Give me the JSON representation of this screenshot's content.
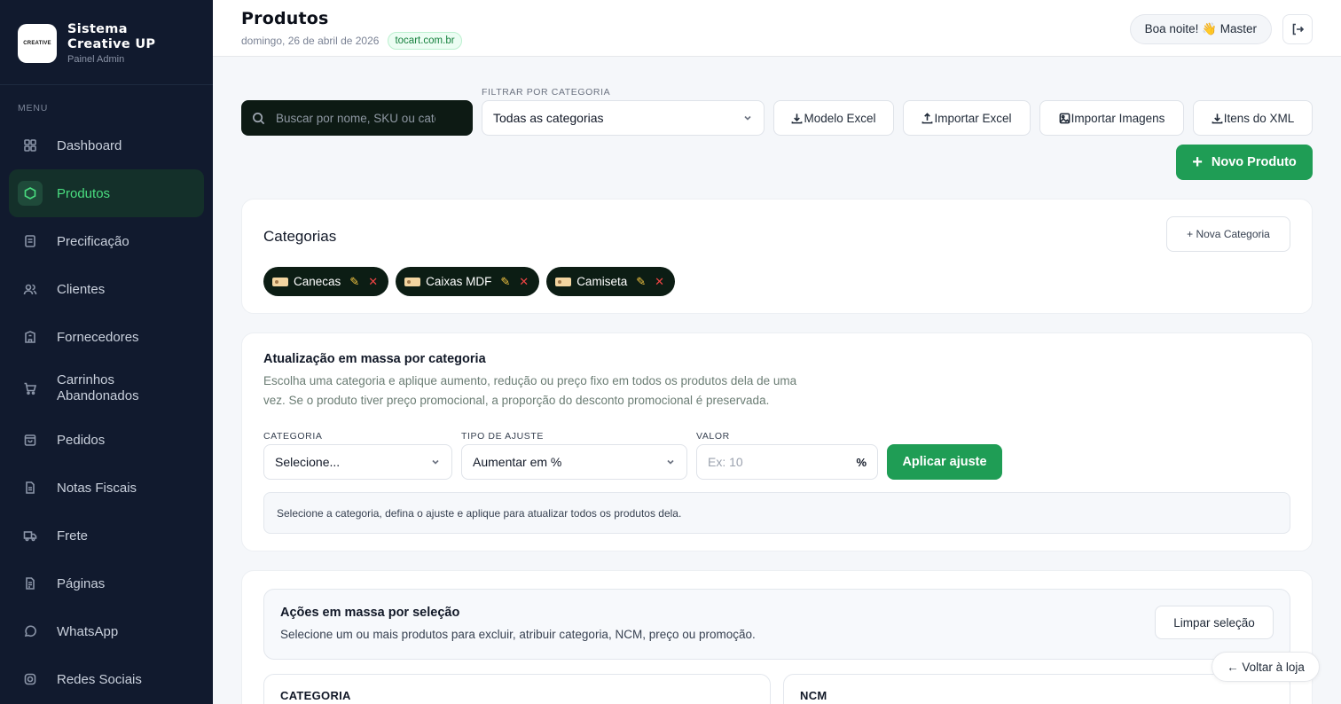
{
  "brand": {
    "logo_text": "CREATIVE",
    "title_line1": "Sistema",
    "title_line2": "Creative UP",
    "subtitle": "Painel Admin"
  },
  "menu_label": "MENU",
  "nav": [
    {
      "label": "Dashboard",
      "icon": "grid-icon",
      "active": false
    },
    {
      "label": "Produtos",
      "icon": "hexagon-icon",
      "active": true
    },
    {
      "label": "Precificação",
      "icon": "document-icon",
      "active": false
    },
    {
      "label": "Clientes",
      "icon": "users-icon",
      "active": false
    },
    {
      "label": "Fornecedores",
      "icon": "building-icon",
      "active": false
    },
    {
      "label": "Carrinhos Abandonados",
      "icon": "cart-icon",
      "active": false
    },
    {
      "label": "Pedidos",
      "icon": "bag-icon",
      "active": false
    },
    {
      "label": "Notas Fiscais",
      "icon": "receipt-icon",
      "active": false
    },
    {
      "label": "Frete",
      "icon": "truck-icon",
      "active": false
    },
    {
      "label": "Páginas",
      "icon": "page-icon",
      "active": false
    },
    {
      "label": "WhatsApp",
      "icon": "chat-icon",
      "active": false
    },
    {
      "label": "Redes Sociais",
      "icon": "instagram-icon",
      "active": false
    }
  ],
  "header": {
    "title": "Produtos",
    "date": "domingo, 26 de abril de 2026",
    "domain": "tocart.com.br",
    "greeting": "Boa noite! 👋 Master"
  },
  "toolbar": {
    "search_placeholder": "Buscar por nome, SKU ou categoria",
    "filter_label": "FILTRAR POR CATEGORIA",
    "filter_value": "Todas as categorias",
    "btn_modelo": "Modelo Excel",
    "btn_importar_excel": "Importar Excel",
    "btn_importar_imagens": "Importar Imagens",
    "btn_itens_xml": "Itens do XML",
    "btn_novo_produto": "Novo Produto"
  },
  "categorias": {
    "title": "Categorias",
    "new_button": "+ Nova Categoria",
    "chips": [
      "Canecas",
      "Caixas MDF",
      "Camiseta"
    ]
  },
  "mass_update": {
    "title": "Atualização em massa por categoria",
    "description": "Escolha uma categoria e aplique aumento, redução ou preço fixo em todos os produtos dela de uma vez. Se o produto tiver preço promocional, a proporção do desconto promocional é preservada.",
    "label_categoria": "CATEGORIA",
    "categoria_value": "Selecione...",
    "label_tipo": "TIPO DE AJUSTE",
    "tipo_value": "Aumentar em %",
    "label_valor": "VALOR",
    "valor_placeholder": "Ex: 10",
    "valor_suffix": "%",
    "apply_button": "Aplicar ajuste",
    "info": "Selecione a categoria, defina o ajuste e aplique para atualizar todos os produtos dela."
  },
  "selection": {
    "title": "Ações em massa por seleção",
    "description": "Selecione um ou mais produtos para excluir, atribuir categoria, NCM, preço ou promoção.",
    "clear_button": "Limpar seleção",
    "col_categoria": "CATEGORIA",
    "col_ncm": "NCM"
  },
  "voltar": "← Voltar à loja"
}
